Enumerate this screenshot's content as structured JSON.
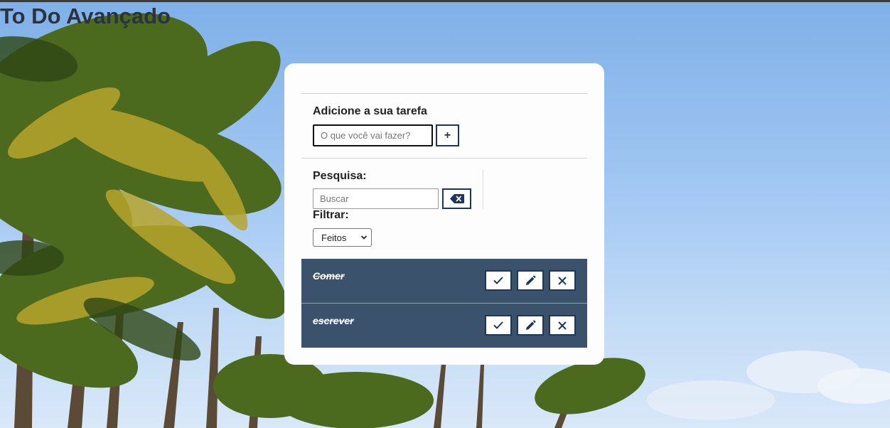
{
  "app": {
    "title": "To Do Avançado"
  },
  "add": {
    "label": "Adicione a sua tarefa",
    "placeholder": "O que você vai fazer?",
    "button_label": "+"
  },
  "search": {
    "label": "Pesquisa:",
    "placeholder": "Buscar",
    "clear_icon": "backspace-icon"
  },
  "filter": {
    "label": "Filtrar:",
    "selected": "Feitos"
  },
  "todos": [
    {
      "text": "Comer",
      "done": true
    },
    {
      "text": "escrever",
      "done": true
    }
  ],
  "colors": {
    "accent": "#1e3658",
    "todo_bg": "#3b526c",
    "card_bg": "#fdfdfd",
    "title": "#2b3340"
  },
  "icons": {
    "done": "check-icon",
    "edit": "pencil-icon",
    "remove": "close-icon"
  }
}
